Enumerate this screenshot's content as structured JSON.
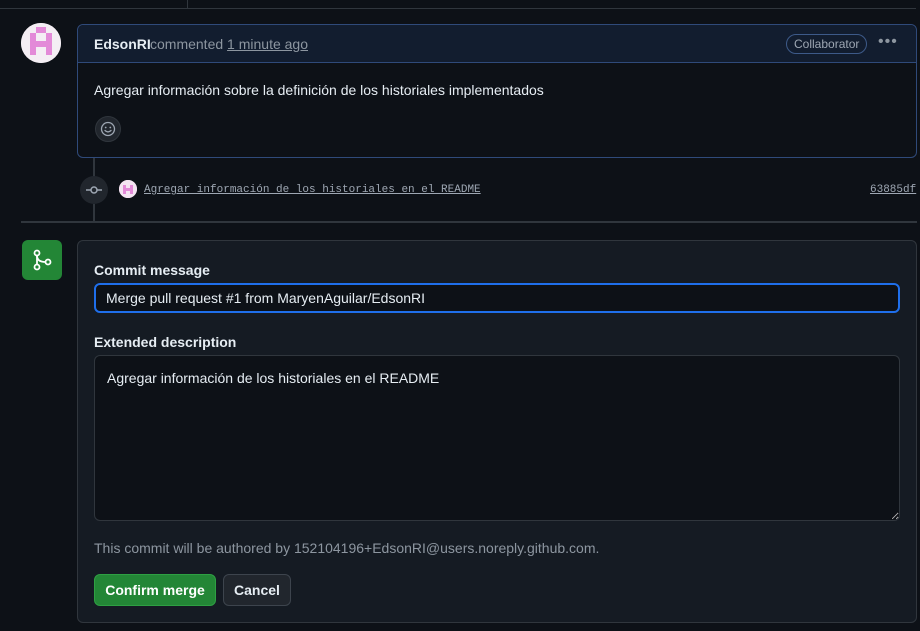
{
  "comment": {
    "author": "EdsonRI",
    "action": "commented",
    "time": "1 minute ago",
    "badge": "Collaborator",
    "menu_icon": "kebab-horizontal-icon",
    "body": "Agregar información sobre la definición de los historiales implementados",
    "reaction_icon": "smiley-icon"
  },
  "commit": {
    "icon": "git-commit-icon",
    "message": "Agregar información de los historiales en el README",
    "sha": "63885df"
  },
  "merge": {
    "icon": "git-merge-icon",
    "commit_message_label": "Commit message",
    "commit_message_value": "Merge pull request #1 from MaryenAguilar/EdsonRI",
    "extended_label": "Extended description",
    "extended_value": "Agregar información de los historiales en el README",
    "author_note": "This commit will be authored by 152104196+EdsonRI@users.noreply.github.com.",
    "confirm_label": "Confirm merge",
    "cancel_label": "Cancel"
  },
  "colors": {
    "background": "#0d1117",
    "accent_blue": "#1f6feb",
    "merge_green": "#238636"
  }
}
